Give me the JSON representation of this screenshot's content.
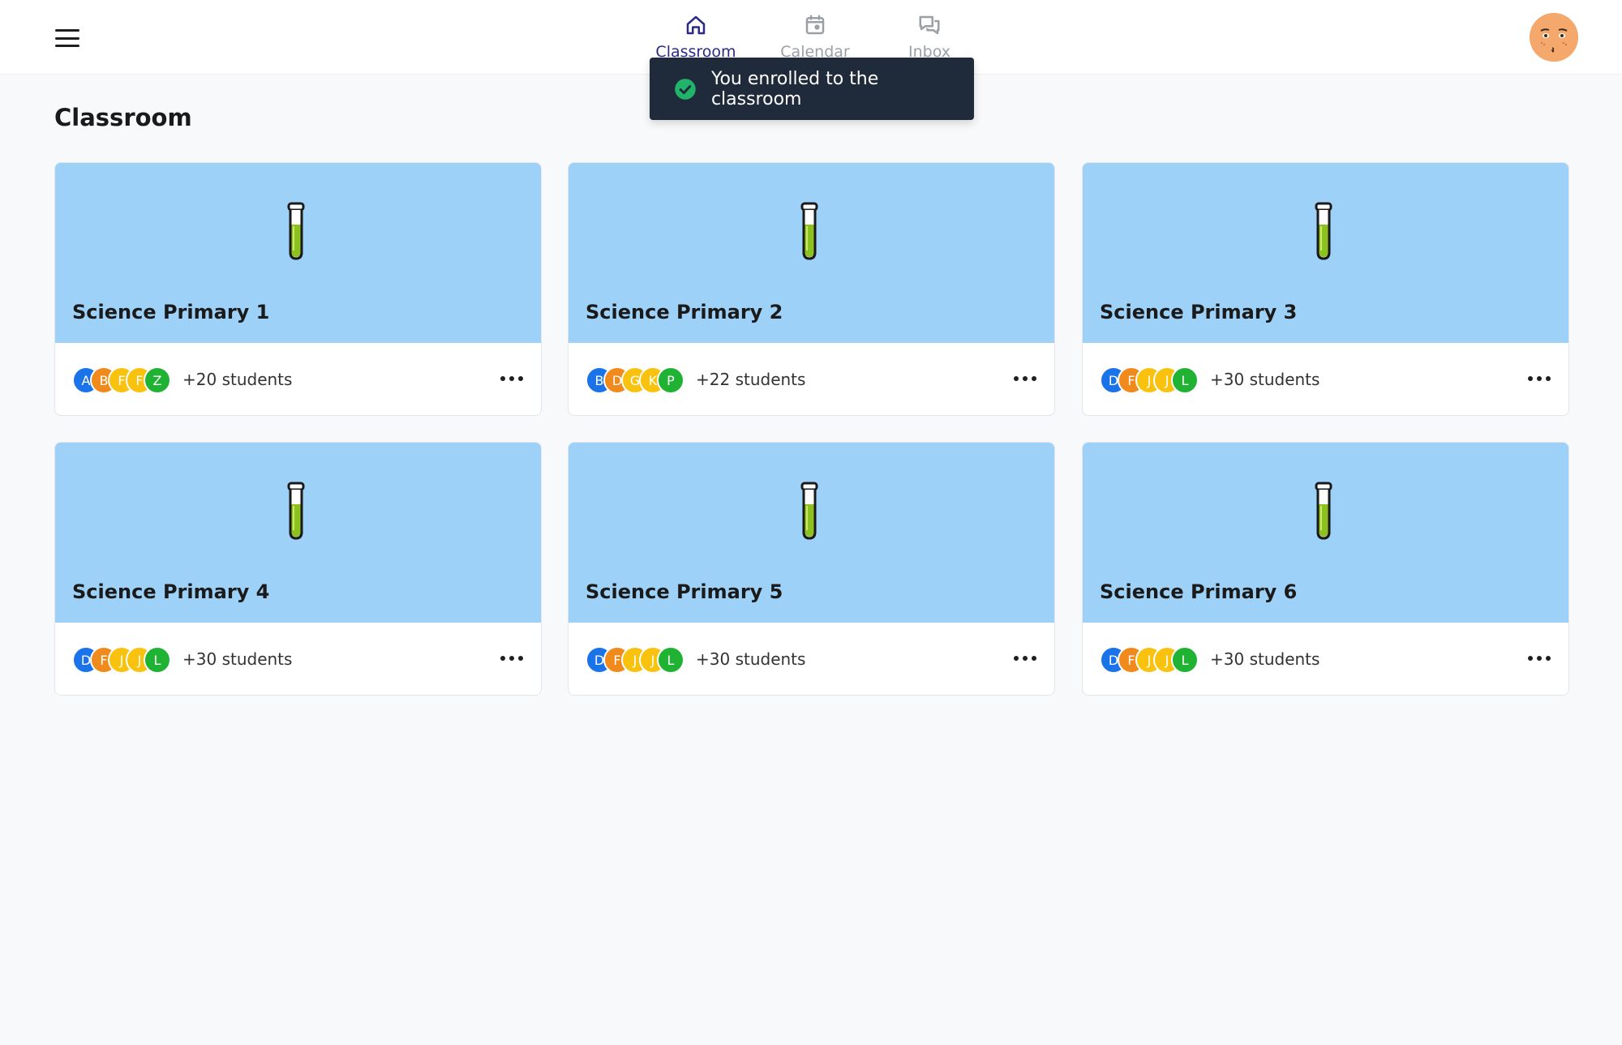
{
  "nav": {
    "items": [
      {
        "label": "Classroom",
        "icon": "home-icon",
        "active": true
      },
      {
        "label": "Calendar",
        "icon": "calendar-icon",
        "active": false
      },
      {
        "label": "Inbox",
        "icon": "chat-icon",
        "active": false
      }
    ]
  },
  "toast": {
    "message": "You enrolled to the classroom",
    "icon": "check-circle-icon"
  },
  "page": {
    "title": "Classroom"
  },
  "colors": {
    "accent": "#2b2a8a",
    "banner": "#9dd1f7",
    "toast_bg": "#1f2a3a",
    "success": "#22b36b",
    "avatar_blue": "#1a73e8",
    "avatar_orange": "#f08a1c",
    "avatar_yellow": "#f8c20f",
    "avatar_green": "#1fb233"
  },
  "classrooms": [
    {
      "title": "Science Primary 1",
      "icon": "test-tube-icon",
      "students": "+20 students",
      "initials": [
        "A",
        "B",
        "F",
        "F",
        "Z"
      ]
    },
    {
      "title": "Science Primary 2",
      "icon": "test-tube-icon",
      "students": "+22 students",
      "initials": [
        "B",
        "D",
        "G",
        "K",
        "P"
      ]
    },
    {
      "title": "Science Primary 3",
      "icon": "test-tube-icon",
      "students": "+30 students",
      "initials": [
        "D",
        "F",
        "J",
        "J",
        "L"
      ]
    },
    {
      "title": "Science Primary 4",
      "icon": "test-tube-icon",
      "students": "+30 students",
      "initials": [
        "D",
        "F",
        "J",
        "J",
        "L"
      ]
    },
    {
      "title": "Science Primary 5",
      "icon": "test-tube-icon",
      "students": "+30 students",
      "initials": [
        "D",
        "F",
        "J",
        "J",
        "L"
      ]
    },
    {
      "title": "Science Primary 6",
      "icon": "test-tube-icon",
      "students": "+30 students",
      "initials": [
        "D",
        "F",
        "J",
        "J",
        "L"
      ]
    }
  ]
}
